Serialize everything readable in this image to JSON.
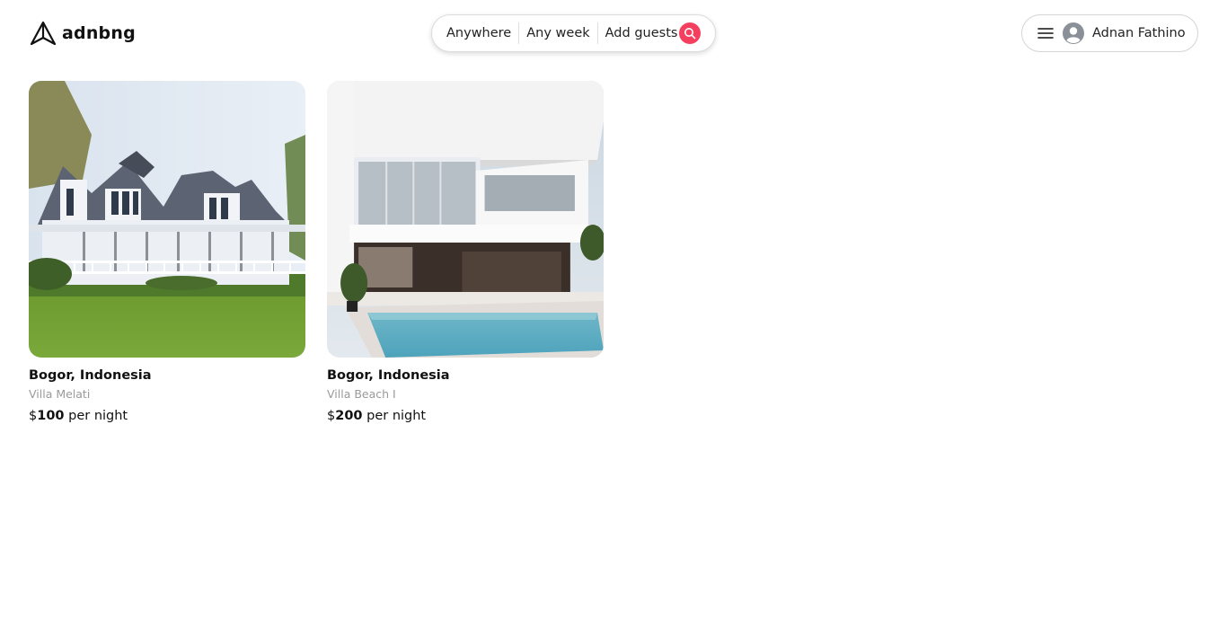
{
  "brand": {
    "name": "adnbng",
    "icon": "paper-plane-icon"
  },
  "search": {
    "location": "Anywhere",
    "week": "Any week",
    "guests": "Add guests",
    "button_icon": "search-icon",
    "accent": "#f43f5e"
  },
  "user": {
    "name": "Adnan Fathino",
    "menu_icon": "hamburger-menu-icon",
    "avatar_icon": "user-avatar-icon"
  },
  "listings": [
    {
      "location": "Bogor, Indonesia",
      "category": "Villa Melati",
      "currency": "$",
      "price": "100",
      "unit": " per night"
    },
    {
      "location": "Bogor, Indonesia",
      "category": "Villa Beach I",
      "currency": "$",
      "price": "200",
      "unit": " per night"
    }
  ]
}
